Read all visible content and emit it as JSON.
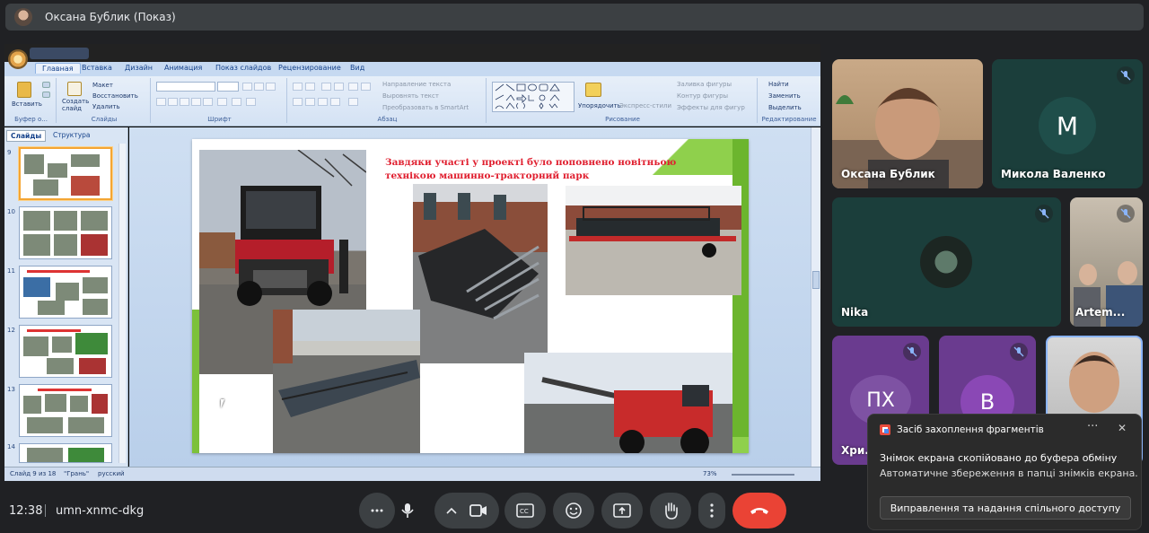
{
  "header": {
    "title": "Оксана Бублик (Показ)"
  },
  "ppt": {
    "tabs": [
      "Главная",
      "Вставка",
      "Дизайн",
      "Анимация",
      "Показ слайдов",
      "Рецензирование",
      "Вид"
    ],
    "groups": {
      "clipboard": "Буфер о...",
      "slides": "Слайды",
      "font": "Шрифт",
      "paragraph": "Абзац",
      "drawing": "Рисование",
      "editing": "Редактирование"
    },
    "buttons": {
      "paste": "Вставить",
      "new_slide": "Создать слайд",
      "layout": "Макет",
      "reset": "Восстановить",
      "delete": "Удалить",
      "text_direction": "Направление текста",
      "align_text": "Выровнять текст",
      "smartart": "Преобразовать в SmartArt",
      "arrange": "Упорядочить",
      "quick_styles": "Экспресс-стили",
      "shape_fill": "Заливка фигуры",
      "shape_outline": "Контур фигуры",
      "shape_effects": "Эффекты для фигур",
      "find": "Найти",
      "replace": "Заменить",
      "select": "Выделить"
    },
    "pane_tabs": [
      "Слайды",
      "Структура"
    ],
    "thumb_numbers": [
      "9",
      "10",
      "11",
      "12",
      "13",
      "14"
    ],
    "status": {
      "slide": "Слайд 9 из 18",
      "theme": "\"Грань\"",
      "lang": "русский",
      "zoom": "73%"
    },
    "slide": {
      "title": "Завдяки участі у проекті  було поповнено новітньою технікою машинно-тракторний парк"
    }
  },
  "participants": [
    {
      "name": "Оксана Бублик"
    },
    {
      "name": "Микола Валенко",
      "initial": "М",
      "color": "#1f4e4a"
    },
    {
      "name": "Nika"
    },
    {
      "name": "Artem..."
    },
    {
      "name": "Хри...",
      "initial": "ПХ"
    },
    {
      "name": "",
      "initial": "В"
    },
    {
      "name": ""
    }
  ],
  "toast": {
    "title": "Засіб захоплення фрагментів",
    "line1": "Знімок екрана скопійовано до буфера обміну",
    "line2": "Автоматичне збереження в папці знімків екрана.",
    "button": "Виправлення та надання спільного доступу"
  },
  "footer": {
    "time": "12:38",
    "meeting_code": "umn-xnmc-dkg"
  },
  "colors": {
    "end_call": "#ea4335",
    "bg": "#202124",
    "control": "#3c4043"
  }
}
